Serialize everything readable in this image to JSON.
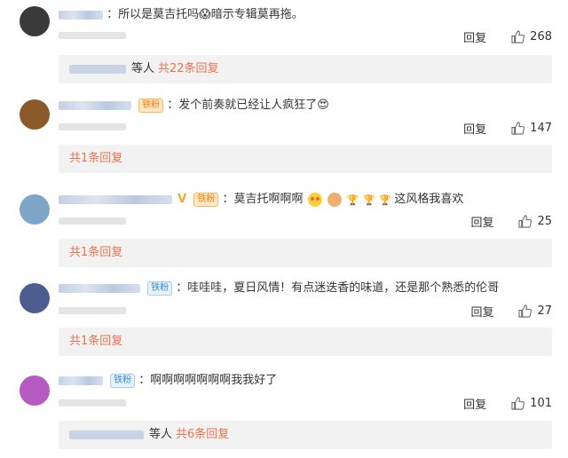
{
  "comments": [
    {
      "avatar_color": "#3a3a3a",
      "badge": "",
      "badge_style": "",
      "vip": false,
      "text": "：所以是莫吉托吗😱暗示专辑莫再拖。",
      "reply_label": "回复",
      "likes": "268",
      "replies": {
        "prefix": "等人",
        "link": "共22条回复"
      }
    },
    {
      "avatar_color": "#8b5a2b",
      "badge": "铁粉",
      "badge_style": "orange",
      "vip": false,
      "text": "：发个前奏就已经让人疯狂了😍",
      "reply_label": "回复",
      "likes": "147",
      "replies": {
        "prefix": "",
        "link": "共1条回复"
      }
    },
    {
      "avatar_color": "#7fa6c8",
      "badge": "铁粉",
      "badge_style": "orange",
      "vip": true,
      "text": "：莫吉托啊啊啊",
      "text2": "这风格我喜欢",
      "reply_label": "回复",
      "likes": "25",
      "replies": {
        "prefix": "",
        "link": "共1条回复"
      }
    },
    {
      "avatar_color": "#4d5d8f",
      "badge": "铁粉",
      "badge_style": "blue",
      "vip": false,
      "text": "：哇哇哇，夏日风情！有点迷迭香的味道，还是那个熟悉的伦哥",
      "reply_label": "回复",
      "likes": "27",
      "replies": {
        "prefix": "",
        "link": "共1条回复"
      }
    },
    {
      "avatar_color": "#b45ac0",
      "badge": "铁粉",
      "badge_style": "blue",
      "vip": false,
      "text": "：啊啊啊啊啊啊啊我我好了",
      "reply_label": "回复",
      "likes": "101",
      "replies": {
        "prefix": "等人",
        "link": "共6条回复"
      }
    }
  ],
  "icons": {
    "like": "thumbs-up-icon",
    "emoji": "emoji-icon",
    "trophy": "trophy-icon"
  },
  "colors": {
    "link": "#eb7350",
    "reply_bg": "#f2f2f2"
  }
}
